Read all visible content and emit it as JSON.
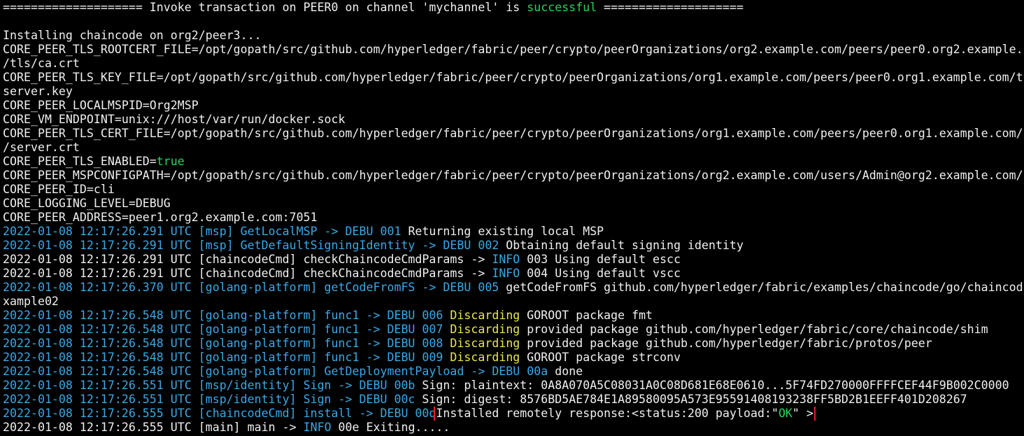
{
  "terminal": {
    "lines": [
      {
        "segments": [
          {
            "text": "==================== Invoke transaction on PEER0 on channel 'mychannel' is ",
            "color": "white"
          },
          {
            "text": "successful",
            "color": "green"
          },
          {
            "text": " ====================",
            "color": "white"
          }
        ]
      },
      {
        "segments": [
          {
            "text": "",
            "color": "white"
          }
        ]
      },
      {
        "segments": [
          {
            "text": "Installing chaincode on org2/peer3...",
            "color": "white"
          }
        ]
      },
      {
        "segments": [
          {
            "text": "CORE_PEER_TLS_ROOTCERT_FILE=/opt/gopath/src/github.com/hyperledger/fabric/peer/crypto/peerOrganizations/org2.example.com/peers/peer0.org2.example.",
            "color": "white"
          }
        ]
      },
      {
        "segments": [
          {
            "text": "/tls/ca.crt",
            "color": "white"
          }
        ]
      },
      {
        "segments": [
          {
            "text": "CORE_PEER_TLS_KEY_FILE=/opt/gopath/src/github.com/hyperledger/fabric/peer/crypto/peerOrganizations/org1.example.com/peers/peer0.org1.example.com/t",
            "color": "white"
          }
        ]
      },
      {
        "segments": [
          {
            "text": "server.key",
            "color": "white"
          }
        ]
      },
      {
        "segments": [
          {
            "text": "CORE_PEER_LOCALMSPID=Org2MSP",
            "color": "white"
          }
        ]
      },
      {
        "segments": [
          {
            "text": "CORE_VM_ENDPOINT=unix:///host/var/run/docker.sock",
            "color": "white"
          }
        ]
      },
      {
        "segments": [
          {
            "text": "CORE_PEER_TLS_CERT_FILE=/opt/gopath/src/github.com/hyperledger/fabric/peer/crypto/peerOrganizations/org1.example.com/peers/peer0.org1.example.com/",
            "color": "white"
          }
        ]
      },
      {
        "segments": [
          {
            "text": "/server.crt",
            "color": "white"
          }
        ]
      },
      {
        "segments": [
          {
            "text": "CORE_PEER_TLS_ENABLED=",
            "color": "white"
          },
          {
            "text": "true",
            "color": "green"
          }
        ]
      },
      {
        "segments": [
          {
            "text": "CORE_PEER_MSPCONFIGPATH=/opt/gopath/src/github.com/hyperledger/fabric/peer/crypto/peerOrganizations/org2.example.com/users/Admin@org2.example.com/",
            "color": "white"
          }
        ]
      },
      {
        "segments": [
          {
            "text": "CORE_PEER_ID=cli",
            "color": "white"
          }
        ]
      },
      {
        "segments": [
          {
            "text": "CORE_LOGGING_LEVEL=DEBUG",
            "color": "white"
          }
        ]
      },
      {
        "segments": [
          {
            "text": "CORE_PEER_ADDRESS=peer1.org2.example.com:7051",
            "color": "white"
          }
        ]
      },
      {
        "segments": [
          {
            "text": "2022-01-08 12:17:26.291 UTC [msp] GetLocalMSP -> DEBU 001",
            "color": "cyan"
          },
          {
            "text": " Returning existing local MSP",
            "color": "white"
          }
        ]
      },
      {
        "segments": [
          {
            "text": "2022-01-08 12:17:26.291 UTC [msp] GetDefaultSigningIdentity -> DEBU 002",
            "color": "cyan"
          },
          {
            "text": " Obtaining default signing identity",
            "color": "white"
          }
        ]
      },
      {
        "segments": [
          {
            "text": "2022-01-08 12:17:26.291 UTC [chaincodeCmd] checkChaincodeCmdParams -> ",
            "color": "white"
          },
          {
            "text": "INFO",
            "color": "cyan"
          },
          {
            "text": " 003 Using default escc",
            "color": "white"
          }
        ]
      },
      {
        "segments": [
          {
            "text": "2022-01-08 12:17:26.291 UTC [chaincodeCmd] checkChaincodeCmdParams -> ",
            "color": "white"
          },
          {
            "text": "INFO",
            "color": "cyan"
          },
          {
            "text": " 004 Using default vscc",
            "color": "white"
          }
        ]
      },
      {
        "segments": [
          {
            "text": "2022-01-08 12:17:26.370 UTC [golang-platform] getCodeFromFS -> DEBU 005",
            "color": "cyan"
          },
          {
            "text": " getCodeFromFS github.com/hyperledger/fabric/examples/chaincode/go/chaincod",
            "color": "white"
          }
        ]
      },
      {
        "segments": [
          {
            "text": "xample02",
            "color": "white"
          }
        ]
      },
      {
        "segments": [
          {
            "text": "2022-01-08 12:17:26.548 UTC [golang-platform] func1 -> DEBU 006",
            "color": "cyan"
          },
          {
            "text": " ",
            "color": "white"
          },
          {
            "text": "Discarding",
            "color": "yellow"
          },
          {
            "text": " GOROOT package fmt",
            "color": "white"
          }
        ]
      },
      {
        "segments": [
          {
            "text": "2022-01-08 12:17:26.548 UTC [golang-platform] func1 -> DEBU 007",
            "color": "cyan"
          },
          {
            "text": " ",
            "color": "white"
          },
          {
            "text": "Discarding",
            "color": "yellow"
          },
          {
            "text": " provided package github.com/hyperledger/fabric/core/chaincode/shim",
            "color": "white"
          }
        ]
      },
      {
        "segments": [
          {
            "text": "2022-01-08 12:17:26.548 UTC [golang-platform] func1 -> DEBU 008",
            "color": "cyan"
          },
          {
            "text": " ",
            "color": "white"
          },
          {
            "text": "Discarding",
            "color": "yellow"
          },
          {
            "text": " provided package github.com/hyperledger/fabric/protos/peer",
            "color": "white"
          }
        ]
      },
      {
        "segments": [
          {
            "text": "2022-01-08 12:17:26.548 UTC [golang-platform] func1 -> DEBU 009",
            "color": "cyan"
          },
          {
            "text": " ",
            "color": "white"
          },
          {
            "text": "Discarding",
            "color": "yellow"
          },
          {
            "text": " GOROOT package strconv",
            "color": "white"
          }
        ]
      },
      {
        "segments": [
          {
            "text": "2022-01-08 12:17:26.548 UTC [golang-platform] GetDeploymentPayload -> DEBU 00a",
            "color": "cyan"
          },
          {
            "text": " done",
            "color": "white"
          }
        ]
      },
      {
        "segments": [
          {
            "text": "2022-01-08 12:17:26.551 UTC [msp/identity] Sign -> DEBU 00b",
            "color": "cyan"
          },
          {
            "text": " Sign: plaintext: 0A8A070A5C08031A0C08D681E68E0610...5F74FD270000FFFFCEF44F9B002C0000",
            "color": "white"
          }
        ]
      },
      {
        "segments": [
          {
            "text": "2022-01-08 12:17:26.551 UTC [msp/identity] Sign -> DEBU 00c",
            "color": "cyan"
          },
          {
            "text": " Sign: digest: 8576BD5AE784E1A89580095A573E95591408193238FF5BD2B1EEFF401D208267",
            "color": "white"
          }
        ]
      },
      {
        "segments": [
          {
            "text": "2022-01-08 12:17:26.555 UTC [chaincodeCmd] install -> DEBU 00d",
            "color": "cyan"
          },
          {
            "text": "Installed remotely response:<status:200 payload:\"",
            "color": "white",
            "box": "start"
          },
          {
            "text": "OK",
            "color": "green",
            "box": "mid"
          },
          {
            "text": "\" >",
            "color": "white",
            "box": "end"
          }
        ]
      },
      {
        "segments": [
          {
            "text": "2022-01-08 12:17:26.555 UTC [main] main -> ",
            "color": "white"
          },
          {
            "text": "INFO",
            "color": "cyan"
          },
          {
            "text": " 00e Exiting.....",
            "color": "white"
          }
        ]
      }
    ]
  },
  "colors": {
    "background": "#000000",
    "text": "#f0f0f0",
    "cyan": "#3aa8e6",
    "green": "#25d45a",
    "yellow": "#e8e84c",
    "highlight_box": "#e0222a"
  }
}
